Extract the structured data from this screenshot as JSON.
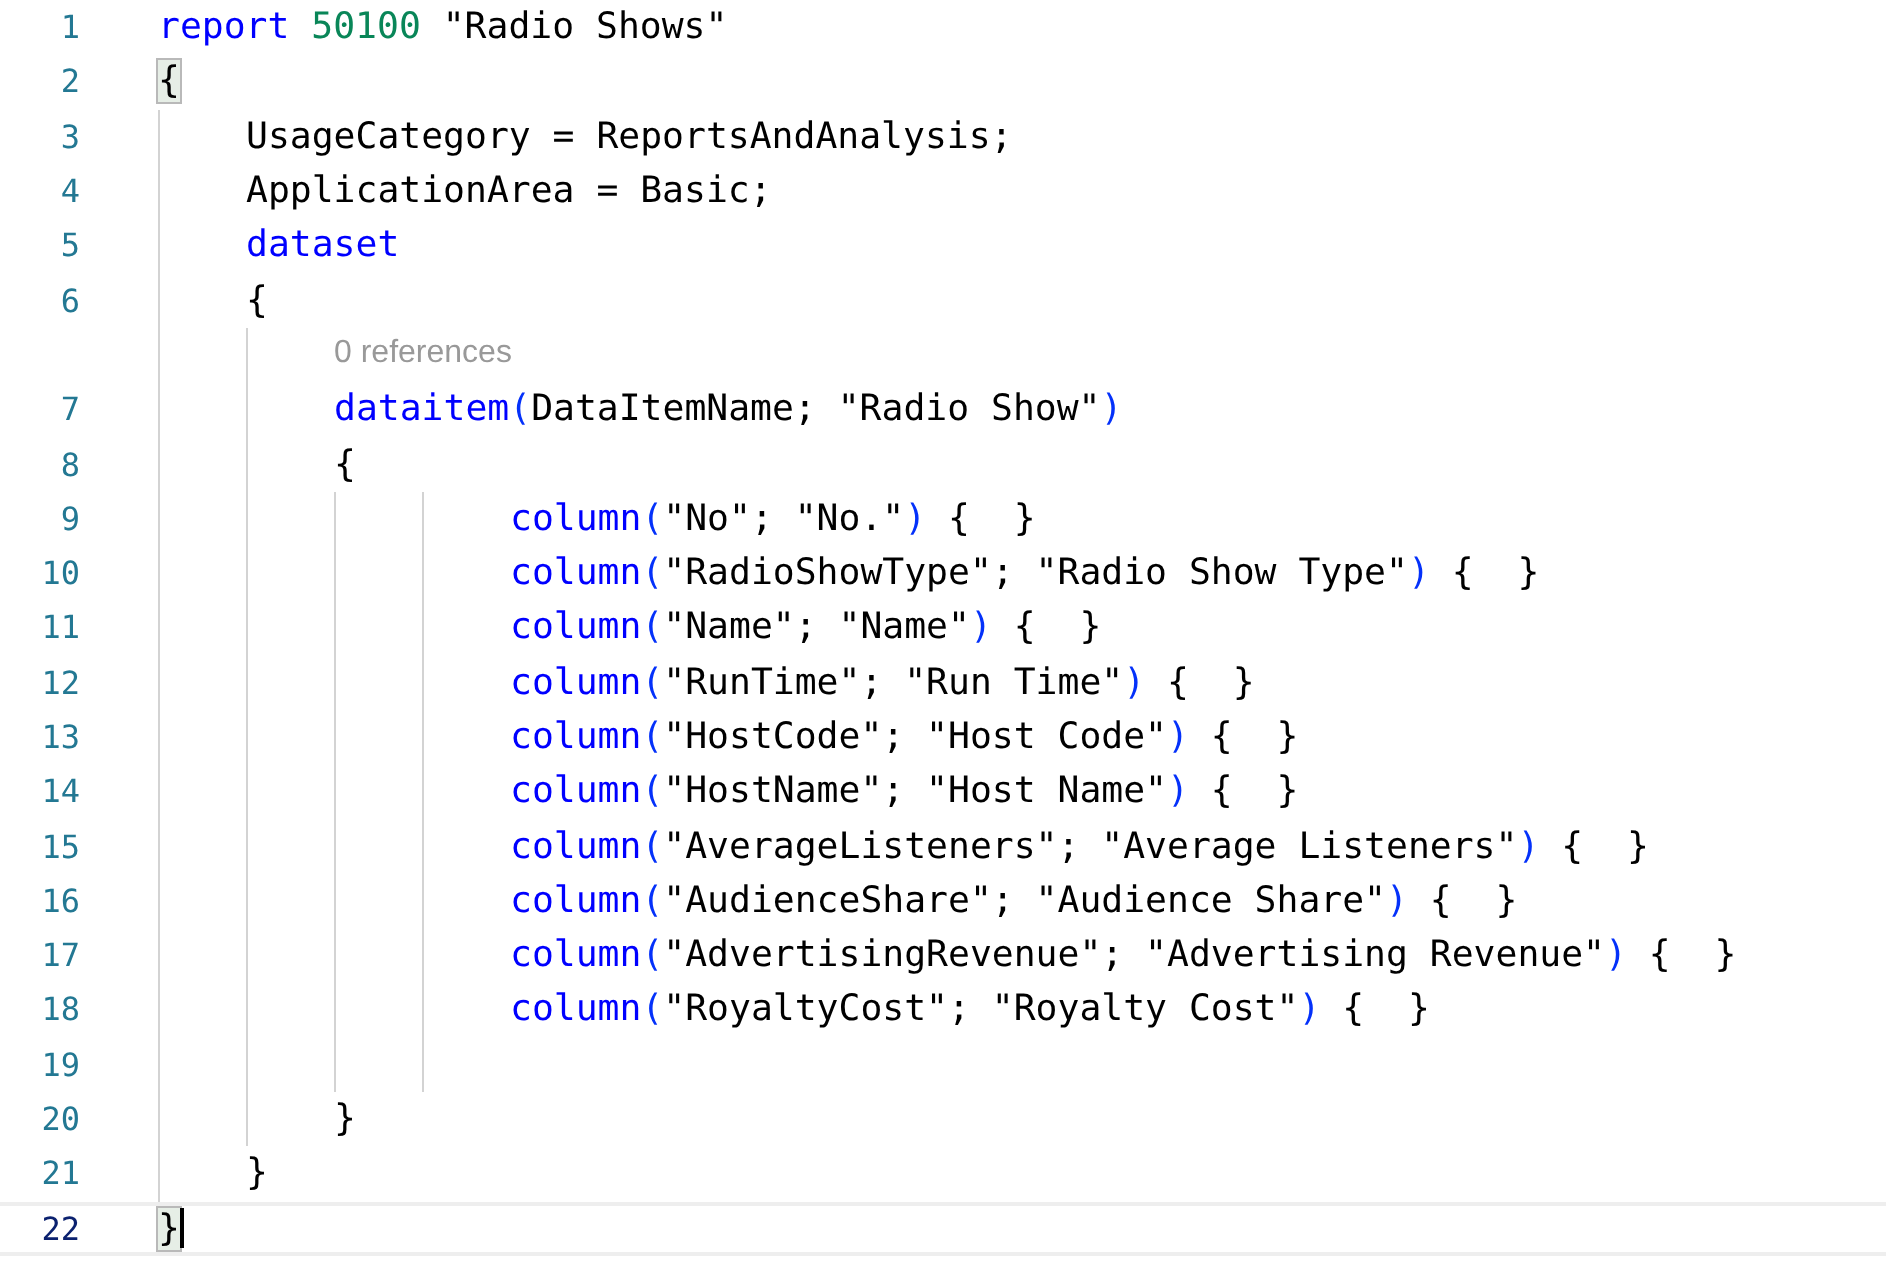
{
  "editor": {
    "lines": [
      {
        "number": "1",
        "tokens": [
          {
            "kind": "keyword",
            "text": "report"
          },
          {
            "kind": "number",
            "text": " 50100"
          },
          {
            "kind": "text",
            "text": " \"Radio Shows\""
          }
        ]
      },
      {
        "number": "2",
        "tokens": [
          {
            "kind": "brace",
            "text": "{",
            "matched": true
          }
        ],
        "children": [
          {
            "number": "3",
            "tokens": [
              {
                "kind": "text",
                "text": "UsageCategory = ReportsAndAnalysis;"
              }
            ]
          },
          {
            "number": "4",
            "tokens": [
              {
                "kind": "text",
                "text": "ApplicationArea = Basic;"
              }
            ]
          },
          {
            "number": "5",
            "tokens": [
              {
                "kind": "keyword",
                "text": "dataset"
              }
            ]
          },
          {
            "number": "6",
            "tokens": [
              {
                "kind": "brace",
                "text": "{"
              }
            ],
            "children": [
              {
                "kind": "codelens",
                "text": "0 references"
              },
              {
                "number": "7",
                "tokens": [
                  {
                    "kind": "keyword",
                    "text": "dataitem"
                  },
                  {
                    "kind": "bracket",
                    "text": "("
                  },
                  {
                    "kind": "text",
                    "text": "DataItemName; \"Radio Show\""
                  },
                  {
                    "kind": "bracket",
                    "text": ")"
                  }
                ]
              },
              {
                "number": "8",
                "tokens": [
                  {
                    "kind": "brace",
                    "text": "{"
                  }
                ],
                "children": [
                  {
                    "children": [
                      {
                        "number": "9",
                        "tokens": [
                          {
                            "kind": "keyword",
                            "text": "column"
                          },
                          {
                            "kind": "bracket",
                            "text": "("
                          },
                          {
                            "kind": "text",
                            "text": "\"No\"; \"No.\""
                          },
                          {
                            "kind": "bracket",
                            "text": ")"
                          },
                          {
                            "kind": "text",
                            "text": " {  }"
                          }
                        ]
                      },
                      {
                        "number": "10",
                        "tokens": [
                          {
                            "kind": "keyword",
                            "text": "column"
                          },
                          {
                            "kind": "bracket",
                            "text": "("
                          },
                          {
                            "kind": "text",
                            "text": "\"RadioShowType\"; \"Radio Show Type\""
                          },
                          {
                            "kind": "bracket",
                            "text": ")"
                          },
                          {
                            "kind": "text",
                            "text": " {  }"
                          }
                        ]
                      },
                      {
                        "number": "11",
                        "tokens": [
                          {
                            "kind": "keyword",
                            "text": "column"
                          },
                          {
                            "kind": "bracket",
                            "text": "("
                          },
                          {
                            "kind": "text",
                            "text": "\"Name\"; \"Name\""
                          },
                          {
                            "kind": "bracket",
                            "text": ")"
                          },
                          {
                            "kind": "text",
                            "text": " {  }"
                          }
                        ]
                      },
                      {
                        "number": "12",
                        "tokens": [
                          {
                            "kind": "keyword",
                            "text": "column"
                          },
                          {
                            "kind": "bracket",
                            "text": "("
                          },
                          {
                            "kind": "text",
                            "text": "\"RunTime\"; \"Run Time\""
                          },
                          {
                            "kind": "bracket",
                            "text": ")"
                          },
                          {
                            "kind": "text",
                            "text": " {  }"
                          }
                        ]
                      },
                      {
                        "number": "13",
                        "tokens": [
                          {
                            "kind": "keyword",
                            "text": "column"
                          },
                          {
                            "kind": "bracket",
                            "text": "("
                          },
                          {
                            "kind": "text",
                            "text": "\"HostCode\"; \"Host Code\""
                          },
                          {
                            "kind": "bracket",
                            "text": ")"
                          },
                          {
                            "kind": "text",
                            "text": " {  }"
                          }
                        ]
                      },
                      {
                        "number": "14",
                        "tokens": [
                          {
                            "kind": "keyword",
                            "text": "column"
                          },
                          {
                            "kind": "bracket",
                            "text": "("
                          },
                          {
                            "kind": "text",
                            "text": "\"HostName\"; \"Host Name\""
                          },
                          {
                            "kind": "bracket",
                            "text": ")"
                          },
                          {
                            "kind": "text",
                            "text": " {  }"
                          }
                        ]
                      },
                      {
                        "number": "15",
                        "tokens": [
                          {
                            "kind": "keyword",
                            "text": "column"
                          },
                          {
                            "kind": "bracket",
                            "text": "("
                          },
                          {
                            "kind": "text",
                            "text": "\"AverageListeners\"; \"Average Listeners\""
                          },
                          {
                            "kind": "bracket",
                            "text": ")"
                          },
                          {
                            "kind": "text",
                            "text": " {  }"
                          }
                        ]
                      },
                      {
                        "number": "16",
                        "tokens": [
                          {
                            "kind": "keyword",
                            "text": "column"
                          },
                          {
                            "kind": "bracket",
                            "text": "("
                          },
                          {
                            "kind": "text",
                            "text": "\"AudienceShare\"; \"Audience Share\""
                          },
                          {
                            "kind": "bracket",
                            "text": ")"
                          },
                          {
                            "kind": "text",
                            "text": " {  }"
                          }
                        ]
                      },
                      {
                        "number": "17",
                        "tokens": [
                          {
                            "kind": "keyword",
                            "text": "column"
                          },
                          {
                            "kind": "bracket",
                            "text": "("
                          },
                          {
                            "kind": "text",
                            "text": "\"AdvertisingRevenue\"; \"Advertising Revenue\""
                          },
                          {
                            "kind": "bracket",
                            "text": ")"
                          },
                          {
                            "kind": "text",
                            "text": " {  }"
                          }
                        ]
                      },
                      {
                        "number": "18",
                        "tokens": [
                          {
                            "kind": "keyword",
                            "text": "column"
                          },
                          {
                            "kind": "bracket",
                            "text": "("
                          },
                          {
                            "kind": "text",
                            "text": "\"RoyaltyCost\"; \"Royalty Cost\""
                          },
                          {
                            "kind": "bracket",
                            "text": ")"
                          },
                          {
                            "kind": "text",
                            "text": " {  }"
                          }
                        ]
                      },
                      {
                        "number": "19"
                      }
                    ]
                  }
                ]
              },
              {
                "number": "20",
                "tokens": [
                  {
                    "kind": "brace",
                    "text": "}"
                  }
                ]
              }
            ]
          },
          {
            "number": "21",
            "tokens": [
              {
                "kind": "brace",
                "text": "}"
              }
            ]
          }
        ]
      },
      {
        "number": "22",
        "current": true,
        "tokens": [
          {
            "kind": "brace",
            "text": "}",
            "matched": true
          }
        ]
      }
    ]
  }
}
